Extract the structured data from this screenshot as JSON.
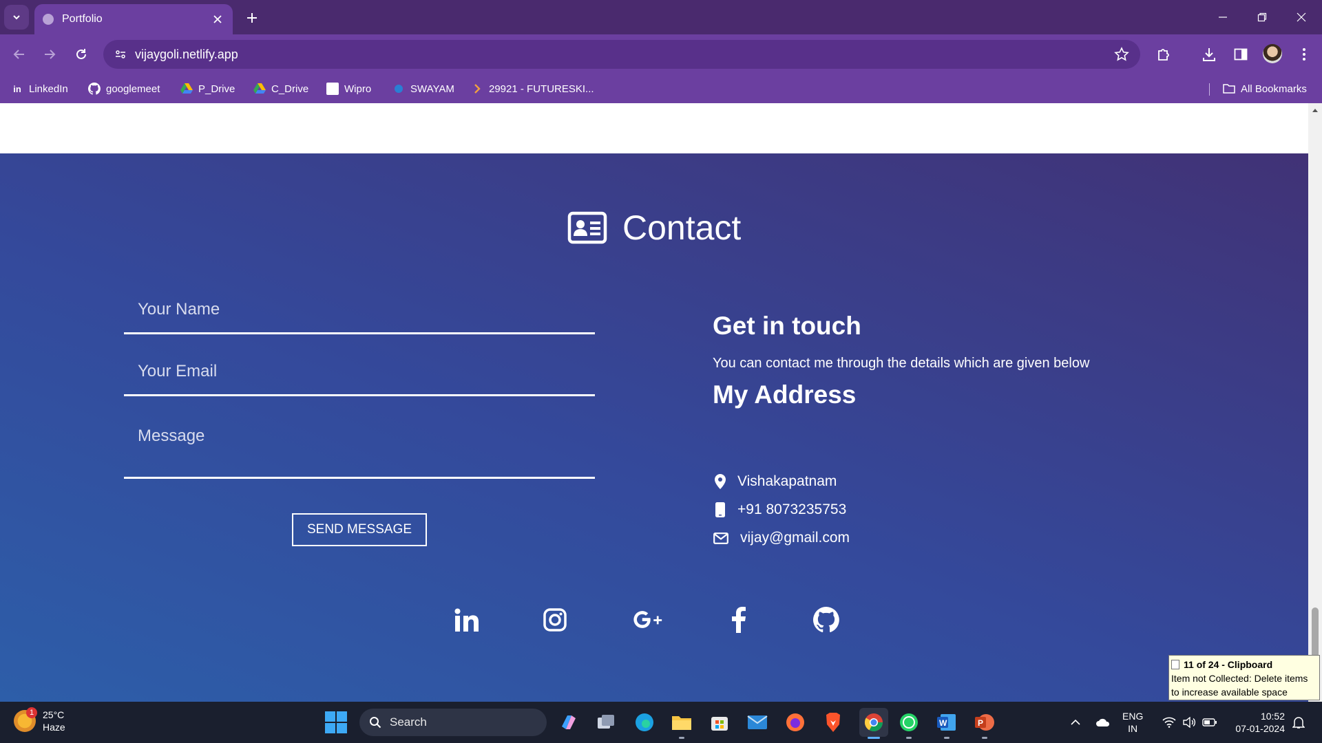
{
  "browser": {
    "tab_title": "Portfolio",
    "url": "vijaygoli.netlify.app",
    "bookmarks": [
      {
        "label": "LinkedIn",
        "icon": "linkedin-icon"
      },
      {
        "label": "googlemeet",
        "icon": "github-icon"
      },
      {
        "label": "P_Drive",
        "icon": "google-drive-icon"
      },
      {
        "label": "C_Drive",
        "icon": "google-drive-icon"
      },
      {
        "label": "Wipro",
        "icon": "wipro-icon"
      },
      {
        "label": "SWAYAM",
        "icon": "swayam-icon"
      },
      {
        "label": "29921 - FUTURESKI...",
        "icon": "chevron-right-icon"
      }
    ],
    "all_bookmarks": "All Bookmarks"
  },
  "contact": {
    "title": "Contact",
    "form": {
      "name_placeholder": "Your Name",
      "email_placeholder": "Your Email",
      "message_placeholder": "Message",
      "send_label": "SEND MESSAGE"
    },
    "get_in_touch_title": "Get in touch",
    "get_in_touch_text": "You can contact me through the details which are given below",
    "address_title": "My Address",
    "address": "Vishakapatnam",
    "phone": "+91 8073235753",
    "email": "vijay@gmail.com",
    "social": [
      "linkedin-icon",
      "instagram-icon",
      "google-plus-icon",
      "facebook-icon",
      "github-icon"
    ]
  },
  "clipboard_toast": {
    "title": "11 of 24 - Clipboard",
    "line1": "Item not Collected: Delete items",
    "line2": "to increase available space"
  },
  "taskbar": {
    "temperature": "25°C",
    "condition": "Haze",
    "weather_badge": "1",
    "search_label": "Search",
    "language_top": "ENG",
    "language_bottom": "IN",
    "time": "10:52",
    "date": "07-01-2024"
  },
  "colors": {
    "chrome": "#6b3fa0",
    "tabbar": "#4a2a6e",
    "section_gradient_start": "#2d5ea9",
    "section_gradient_end": "#413276"
  }
}
